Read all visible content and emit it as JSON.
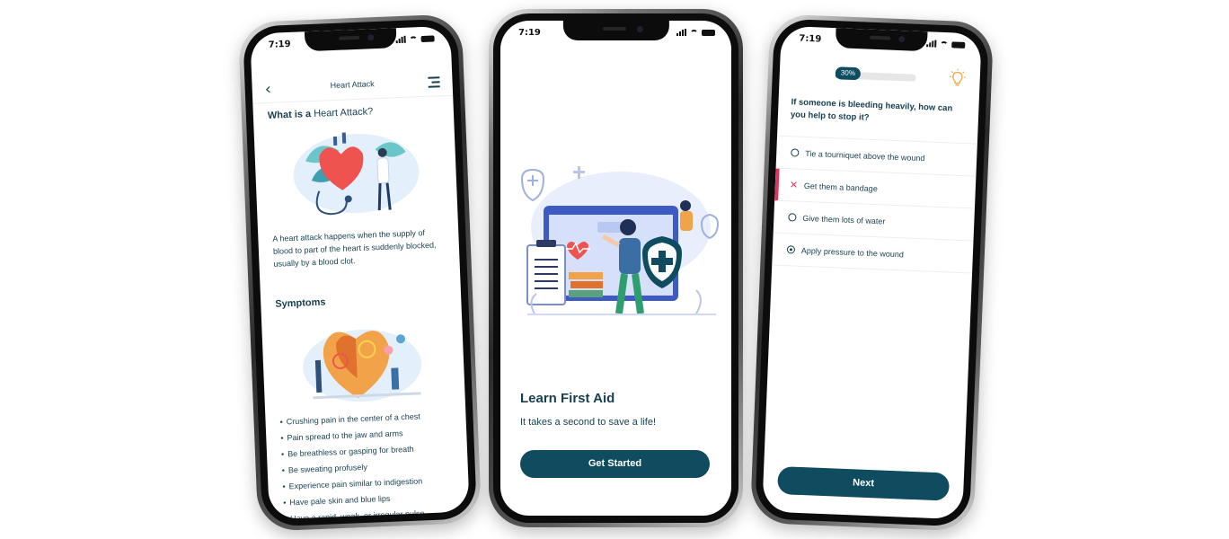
{
  "left_phone": {
    "status_time": "7:19",
    "header_title": "Heart Attack",
    "section1": {
      "title_bold": "What is a",
      "title_light": "Heart Attack?"
    },
    "description": "A heart attack happens when the supply of blood to part of the heart is suddenly blocked, usually by a blood clot.",
    "section2_title": "Symptoms",
    "symptoms": [
      "Crushing pain in the center of a chest",
      "Pain spread to the jaw and arms",
      "Be breathless or gasping for breath",
      "Be sweating profusely",
      "Experience pain similar to indigestion",
      "Have pale skin and blue lips",
      "Have a rapid, weak, or irregular pulse"
    ]
  },
  "center_phone": {
    "status_time": "7:19",
    "title": "Learn First Aid",
    "subtitle": "It takes a second to save a life!",
    "button_label": "Get Started"
  },
  "right_phone": {
    "status_time": "7:19",
    "progress_percent": 30,
    "progress_label": "30%",
    "question": "If someone is bleeding heavily, how can you help to stop it?",
    "options": [
      {
        "label": "Tie a tourniquet above the wound",
        "state": "unselected"
      },
      {
        "label": "Get them a bandage",
        "state": "wrong"
      },
      {
        "label": "Give them lots of water",
        "state": "unselected"
      },
      {
        "label": "Apply pressure to the wound",
        "state": "selected"
      }
    ],
    "button_label": "Next"
  },
  "colors": {
    "primary": "#0f4c5f",
    "text": "#173f4f",
    "error": "#e1335e",
    "accent_red": "#ef5350",
    "bulb": "#f5a54a"
  }
}
